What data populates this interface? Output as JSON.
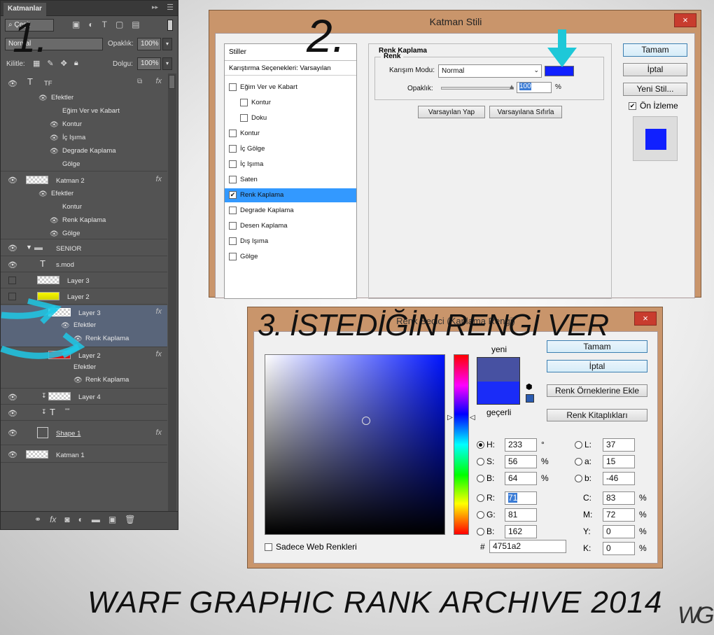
{
  "layers_panel": {
    "tab": "Katmanlar",
    "filter": "Çeşit",
    "blend_mode": "Normal",
    "opacity_label": "Opaklık:",
    "opacity": "100%",
    "lock_label": "Kilitle:",
    "fill_label": "Dolgu:",
    "fill": "100%",
    "rows": {
      "tf": "TF",
      "tf_effects": "Efektler",
      "tf_bevel": "Eğim Ver ve Kabart",
      "tf_stroke": "Kontur",
      "tf_inner_glow": "İç Işıma",
      "tf_gradient": "Degrade Kaplama",
      "tf_shadow": "Gölge",
      "katman2": "Katman 2",
      "k2_effects": "Efektler",
      "k2_stroke": "Kontur",
      "k2_color": "Renk Kaplama",
      "k2_shadow": "Gölge",
      "senior": "SENIOR",
      "smod": "s.mod",
      "layer3a": "Layer 3",
      "layer2a": "Layer 2",
      "layer3b": "Layer 3",
      "l3_effects": "Efektler",
      "l3_color": "Renk Kaplama",
      "layer2b": "Layer 2",
      "l2_effects": "Efektler",
      "l2_color": "Renk Kaplama",
      "layer4": "Layer 4",
      "text_w": "\"\"",
      "shape1": "Shape 1",
      "katman1": "Katman 1"
    }
  },
  "step_labels": {
    "one": "1.",
    "two": "2.",
    "three": "3. İSTEDİĞİN RENGİ VER"
  },
  "layer_style": {
    "title": "Katman Stili",
    "close": "×",
    "styles_header": "Stiller",
    "blend_options": "Karıştırma Seçenekleri: Varsayılan",
    "styles": [
      "Eğim Ver ve Kabart",
      "Kontur",
      "Doku",
      "Kontur",
      "İç Gölge",
      "İç Işıma",
      "Saten",
      "Renk Kaplama",
      "Degrade Kaplama",
      "Desen Kaplama",
      "Dış Işıma",
      "Gölge"
    ],
    "selected_style": "Renk Kaplama",
    "section_title": "Renk Kaplama",
    "group_title": "Renk",
    "blend_mode_label": "Karışım Modu:",
    "blend_mode": "Normal",
    "opacity_label": "Opaklık:",
    "opacity": "100",
    "percent": "%",
    "make_default": "Varsayılan Yap",
    "reset_default": "Varsayılana Sıfırla",
    "ok": "Tamam",
    "cancel": "İptal",
    "new_style": "Yeni Stil...",
    "preview": "Ön İzleme",
    "swatch_color": "#1020ff"
  },
  "color_picker": {
    "title": "Renk Seçici (Kaplama Rengi)",
    "close": "×",
    "new_label": "yeni",
    "current_label": "geçerli",
    "new_color": "#4751a2",
    "current_color": "#1a2cf8",
    "ok": "Tamam",
    "cancel": "İptal",
    "add_swatches": "Renk Örneklerine Ekle",
    "libraries": "Renk Kitaplıkları",
    "fields": {
      "H": "233",
      "S": "56",
      "B": "64",
      "R": "71",
      "G": "81",
      "Bb": "162",
      "L": "37",
      "a": "15",
      "b": "-46",
      "C": "83",
      "M": "72",
      "Y": "0",
      "K": "0"
    },
    "units": {
      "deg": "°",
      "pct": "%"
    },
    "hex_label": "#",
    "hex": "4751a2",
    "web_only": "Sadece Web Renkleri"
  },
  "footer": {
    "title": "WARF GRAPHIC RANK ARCHIVE 2014",
    "logo": "WG"
  }
}
